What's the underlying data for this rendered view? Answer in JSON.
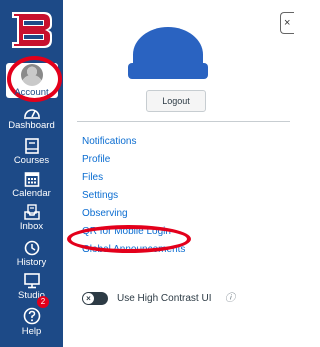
{
  "nav": {
    "items": [
      {
        "key": "account",
        "label": "Account",
        "icon": "person-icon"
      },
      {
        "key": "dashboard",
        "label": "Dashboard",
        "icon": "dashboard-icon"
      },
      {
        "key": "courses",
        "label": "Courses",
        "icon": "book-icon"
      },
      {
        "key": "calendar",
        "label": "Calendar",
        "icon": "calendar-icon"
      },
      {
        "key": "inbox",
        "label": "Inbox",
        "icon": "inbox-icon"
      },
      {
        "key": "history",
        "label": "History",
        "icon": "clock-icon"
      },
      {
        "key": "studio",
        "label": "Studio",
        "icon": "monitor-icon"
      },
      {
        "key": "help",
        "label": "Help",
        "icon": "question-icon",
        "badge": "2"
      }
    ],
    "colors": {
      "nav_bg": "#1d4a87",
      "highlight_ring": "#e3001b",
      "logo_red": "#c8102e"
    }
  },
  "tray": {
    "close_label": "×",
    "logout_label": "Logout",
    "links": [
      "Notifications",
      "Profile",
      "Files",
      "Settings",
      "Observing",
      "QR for Mobile Login",
      "Global Announcements"
    ],
    "high_contrast_label": "Use High Contrast UI",
    "toggle_glyph": "×",
    "info_glyph": "ⓘ",
    "colors": {
      "link": "#0b6dd1",
      "avatar": "#2a63c1"
    }
  }
}
